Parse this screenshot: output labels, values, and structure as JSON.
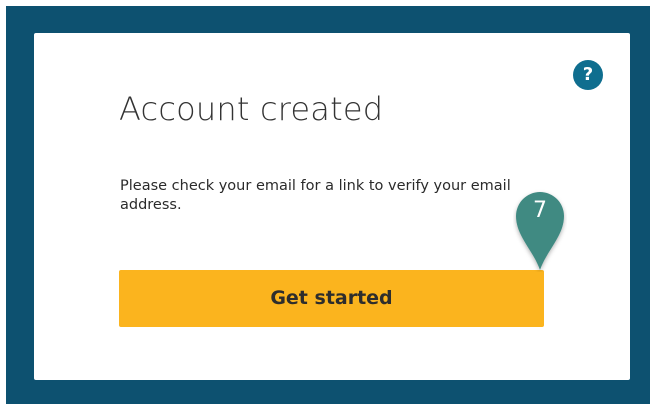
{
  "dialog": {
    "title": "Account created",
    "message": "Please check your email for a link to verify your email address.",
    "cta_label": "Get started",
    "help_symbol": "?",
    "help_icon": "question-circle-icon"
  },
  "annotation": {
    "step_number": "7",
    "icon": "map-pin-marker-icon",
    "color": "#3f8a82"
  },
  "colors": {
    "backdrop": "#0d5170",
    "cta": "#fbb41e",
    "help": "#0f6e8f"
  }
}
